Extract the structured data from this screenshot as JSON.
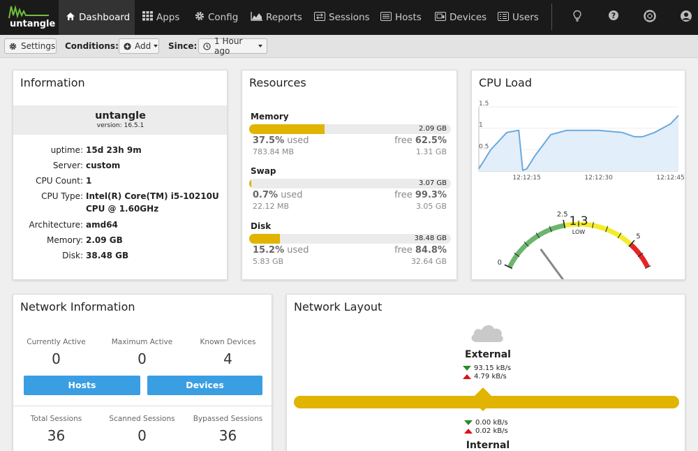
{
  "nav": {
    "logo_text": "untangle",
    "items": [
      {
        "label": "Dashboard",
        "icon": "home-icon"
      },
      {
        "label": "Apps",
        "icon": "grid-icon"
      },
      {
        "label": "Config",
        "icon": "gear-icon"
      },
      {
        "label": "Reports",
        "icon": "area-chart-icon"
      },
      {
        "label": "Sessions",
        "icon": "exchange-icon"
      },
      {
        "label": "Hosts",
        "icon": "list-icon"
      },
      {
        "label": "Devices",
        "icon": "devices-icon"
      },
      {
        "label": "Users",
        "icon": "users-icon"
      }
    ],
    "right_icons": [
      "lightbulb-icon",
      "help-icon",
      "support-icon",
      "account-icon"
    ]
  },
  "toolbar": {
    "settings_label": "Settings",
    "conditions_label": "Conditions:",
    "add_label": "Add",
    "since_label": "Since:",
    "since_value": "1 Hour ago"
  },
  "information": {
    "title": "Information",
    "name": "untangle",
    "version": "version: 16.5.1",
    "rows": [
      {
        "key": "uptime:",
        "value": "15d 23h 9m"
      },
      {
        "key": "Server:",
        "value": "custom"
      },
      {
        "key": "CPU Count:",
        "value": "1"
      },
      {
        "key": "CPU Type:",
        "value": "Intel(R) Core(TM) i5-10210U CPU @ 1.60GHz"
      },
      {
        "key": "Architecture:",
        "value": "amd64"
      },
      {
        "key": "Memory:",
        "value": "2.09 GB"
      },
      {
        "key": "Disk:",
        "value": "38.48 GB"
      }
    ]
  },
  "resources": {
    "title": "Resources",
    "items": [
      {
        "label": "Memory",
        "total": "2.09 GB",
        "used_pct": "37.5%",
        "used_word": "used",
        "used_amount": "783.84 MB",
        "free_word": "free",
        "free_pct": "62.5%",
        "free_amount": "1.31 GB",
        "fill": 0.375
      },
      {
        "label": "Swap",
        "total": "3.07 GB",
        "used_pct": "0.7%",
        "used_word": "used",
        "used_amount": "22.12 MB",
        "free_word": "free",
        "free_pct": "99.3%",
        "free_amount": "3.05 GB",
        "fill": 0.007
      },
      {
        "label": "Disk",
        "total": "38.48 GB",
        "used_pct": "15.2%",
        "used_word": "used",
        "used_amount": "5.83 GB",
        "free_word": "free",
        "free_pct": "84.8%",
        "free_amount": "32.64 GB",
        "fill": 0.152
      }
    ]
  },
  "cpu_load": {
    "title": "CPU Load",
    "gauge": {
      "value": "1.3",
      "status": "LOW",
      "min_label": "0",
      "mid_label": "2.5",
      "max_label": "5",
      "numeric_value": 1.3,
      "max": 6
    }
  },
  "chart_data": {
    "type": "area",
    "title": "",
    "xlabel": "",
    "ylabel": "",
    "y_ticks": [
      "0",
      "0.5",
      "1",
      "1.5"
    ],
    "x_ticks": [
      "12:12:15",
      "12:12:30",
      "12:12:45"
    ],
    "ylim": [
      0,
      1.5
    ],
    "x": [
      0,
      3,
      7,
      10,
      11,
      12,
      14,
      18,
      22,
      26,
      30,
      36,
      39,
      41,
      44,
      48,
      50
    ],
    "values": [
      0.05,
      0.5,
      0.9,
      0.95,
      0.02,
      0.05,
      0.35,
      0.85,
      0.95,
      0.95,
      0.95,
      0.9,
      0.8,
      0.8,
      0.9,
      1.1,
      1.3
    ],
    "xlim": [
      0,
      50
    ],
    "grid": true,
    "colors": {
      "line": "#6aa9dc",
      "fill": "#e2eef9"
    }
  },
  "network_information": {
    "title": "Network Information",
    "top_stats": [
      {
        "label": "Currently Active",
        "value": "0"
      },
      {
        "label": "Maximum Active",
        "value": "0"
      },
      {
        "label": "Known Devices",
        "value": "4"
      }
    ],
    "hosts_button": "Hosts",
    "devices_button": "Devices",
    "bottom_stats": [
      {
        "label": "Total Sessions",
        "value": "36"
      },
      {
        "label": "Scanned Sessions",
        "value": "0"
      },
      {
        "label": "Bypassed Sessions",
        "value": "36"
      }
    ]
  },
  "network_layout": {
    "title": "Network Layout",
    "external": {
      "name": "External",
      "down": "93.15 kB/s",
      "up": "4.79 kB/s"
    },
    "internal": {
      "name": "Internal",
      "down": "0.00 kB/s",
      "up": "0.02 kB/s"
    }
  },
  "colors": {
    "accent": "#e0b400",
    "button_blue": "#3a9ee3",
    "nav_bg": "#1a1a1a",
    "gauge_green": "#6db56d",
    "gauge_yellow": "#f3ec29",
    "gauge_red": "#e42525"
  }
}
